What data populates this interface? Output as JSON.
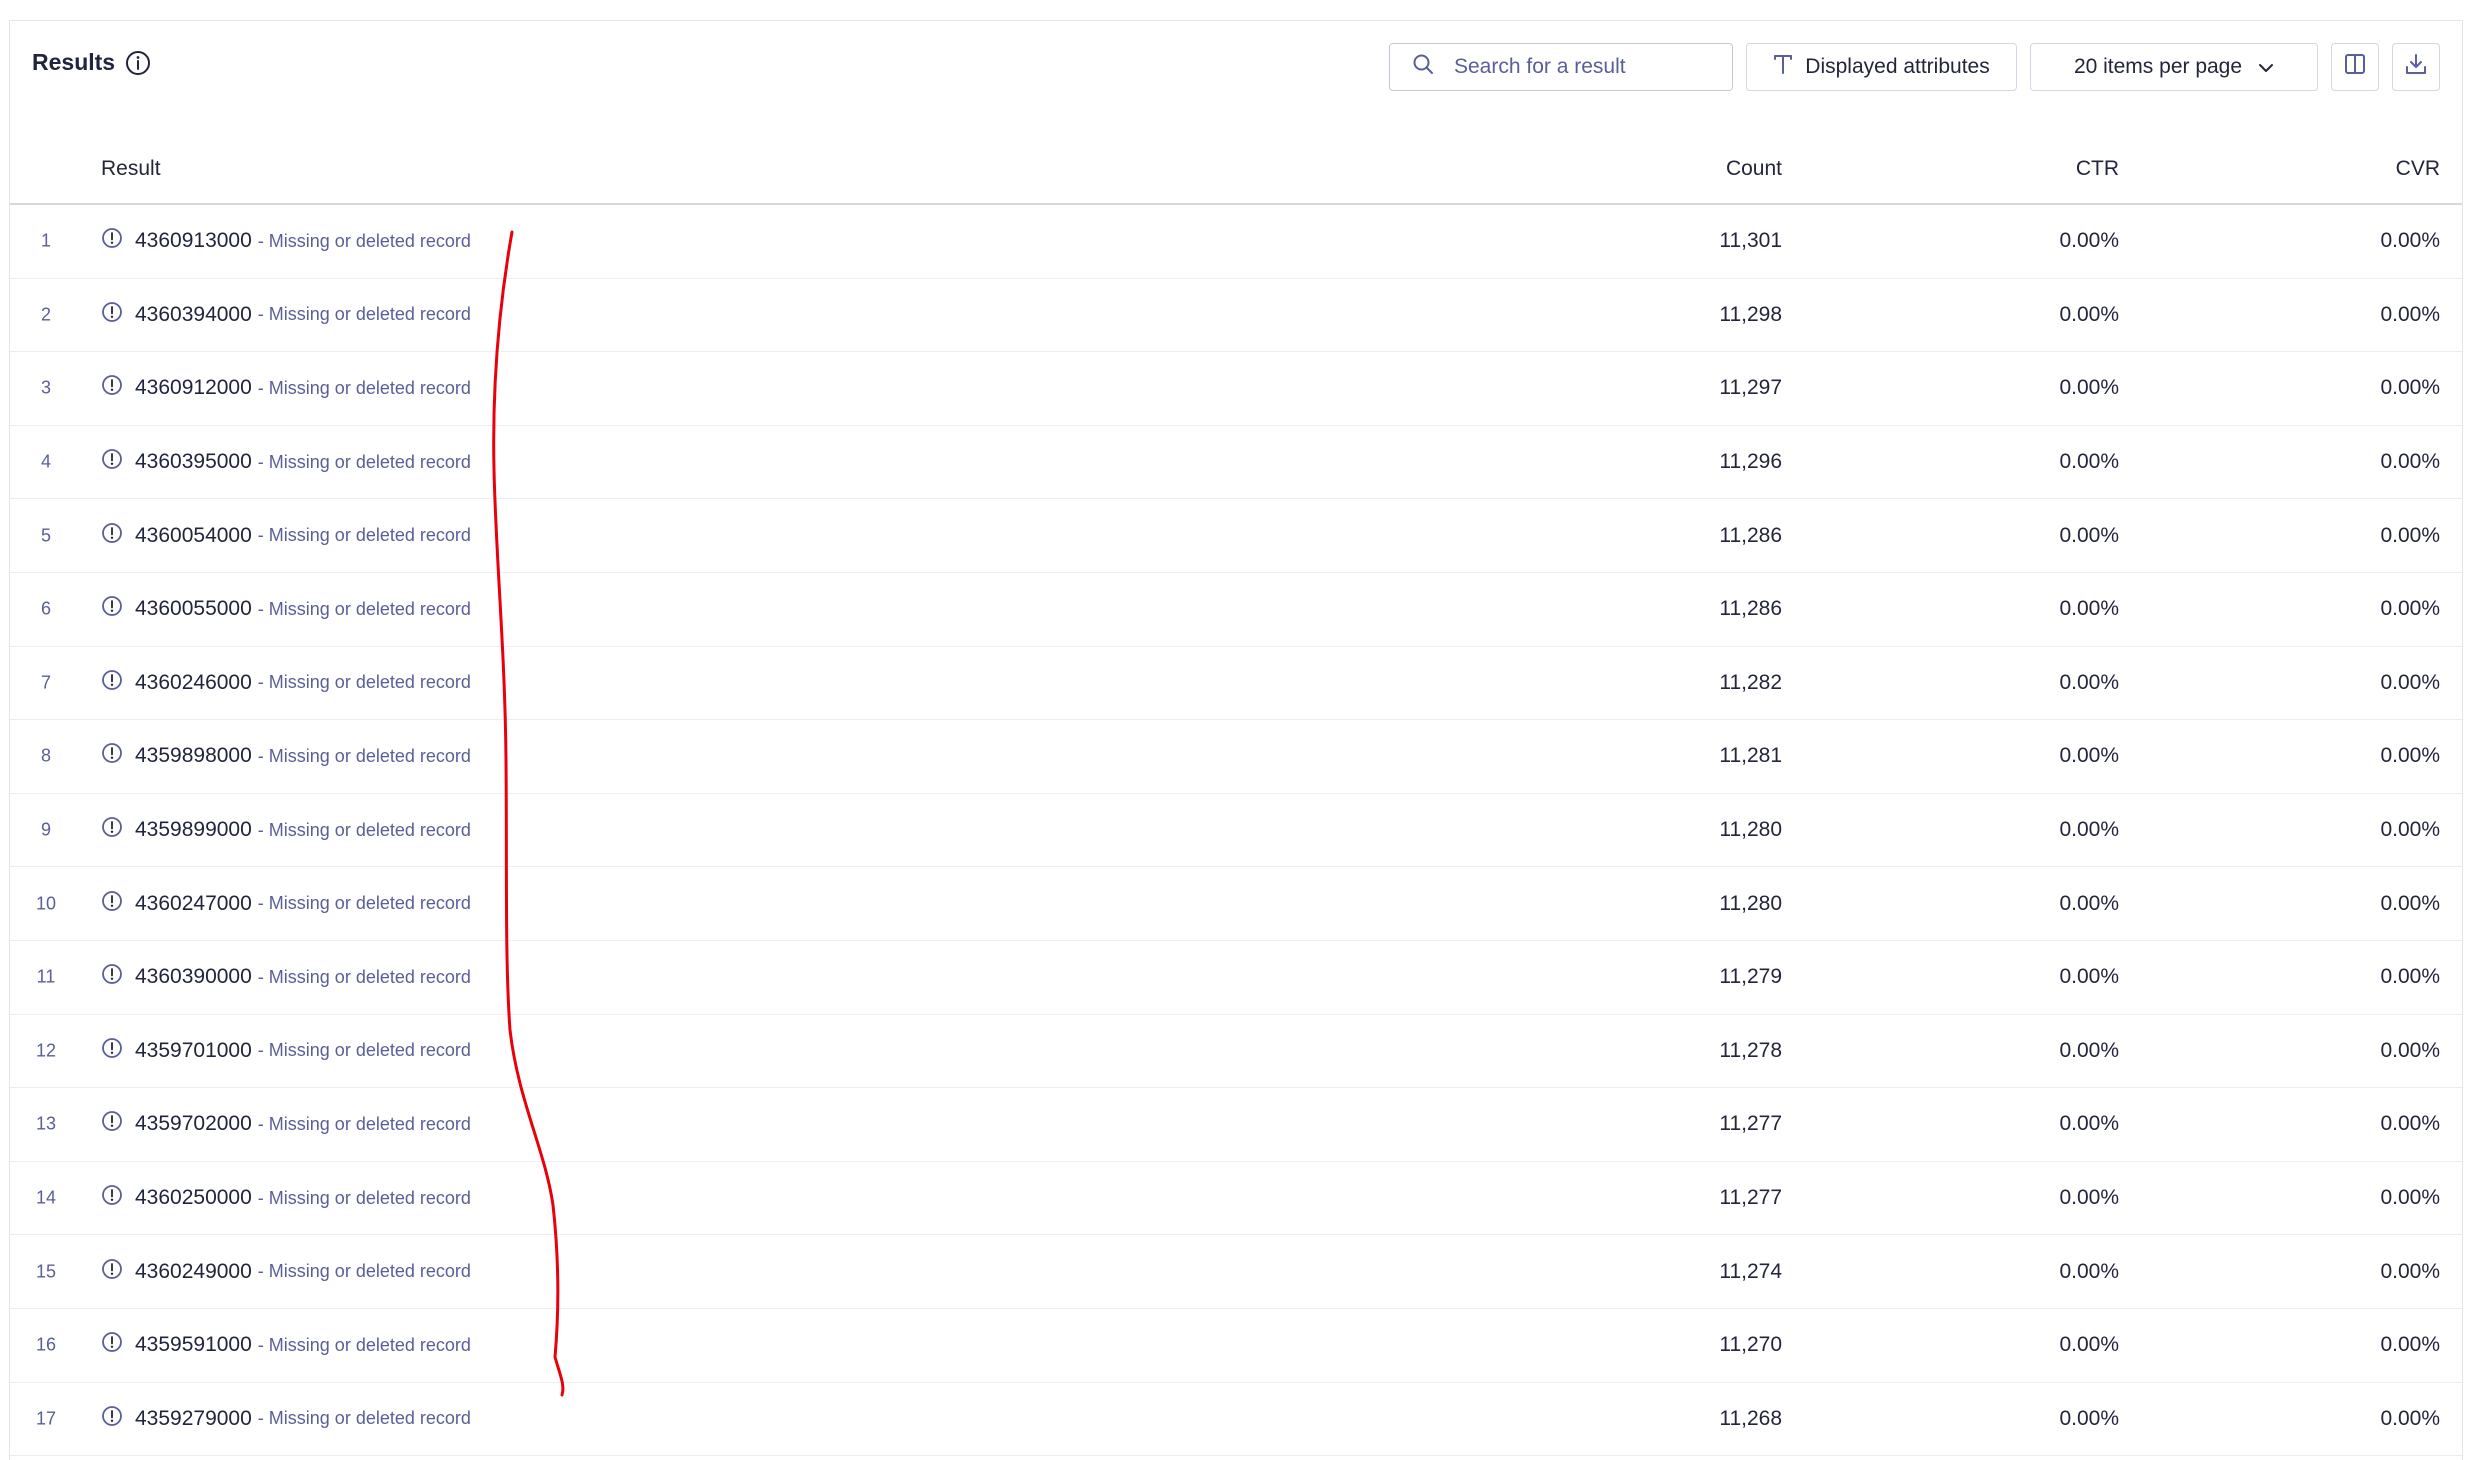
{
  "header": {
    "title": "Results"
  },
  "toolbar": {
    "search_placeholder": "Search for a result",
    "attributes_label": "Displayed attributes",
    "per_page_label": "20 items per page"
  },
  "columns": {
    "result": "Result",
    "count": "Count",
    "ctr": "CTR",
    "cvr": "CVR"
  },
  "rows": [
    {
      "rank": "1",
      "id": "4360913000",
      "note": "- Missing or deleted record",
      "count": "11,301",
      "ctr": "0.00%",
      "cvr": "0.00%"
    },
    {
      "rank": "2",
      "id": "4360394000",
      "note": "- Missing or deleted record",
      "count": "11,298",
      "ctr": "0.00%",
      "cvr": "0.00%"
    },
    {
      "rank": "3",
      "id": "4360912000",
      "note": "- Missing or deleted record",
      "count": "11,297",
      "ctr": "0.00%",
      "cvr": "0.00%"
    },
    {
      "rank": "4",
      "id": "4360395000",
      "note": "- Missing or deleted record",
      "count": "11,296",
      "ctr": "0.00%",
      "cvr": "0.00%"
    },
    {
      "rank": "5",
      "id": "4360054000",
      "note": "- Missing or deleted record",
      "count": "11,286",
      "ctr": "0.00%",
      "cvr": "0.00%"
    },
    {
      "rank": "6",
      "id": "4360055000",
      "note": "- Missing or deleted record",
      "count": "11,286",
      "ctr": "0.00%",
      "cvr": "0.00%"
    },
    {
      "rank": "7",
      "id": "4360246000",
      "note": "- Missing or deleted record",
      "count": "11,282",
      "ctr": "0.00%",
      "cvr": "0.00%"
    },
    {
      "rank": "8",
      "id": "4359898000",
      "note": "- Missing or deleted record",
      "count": "11,281",
      "ctr": "0.00%",
      "cvr": "0.00%"
    },
    {
      "rank": "9",
      "id": "4359899000",
      "note": "- Missing or deleted record",
      "count": "11,280",
      "ctr": "0.00%",
      "cvr": "0.00%"
    },
    {
      "rank": "10",
      "id": "4360247000",
      "note": "- Missing or deleted record",
      "count": "11,280",
      "ctr": "0.00%",
      "cvr": "0.00%"
    },
    {
      "rank": "11",
      "id": "4360390000",
      "note": "- Missing or deleted record",
      "count": "11,279",
      "ctr": "0.00%",
      "cvr": "0.00%"
    },
    {
      "rank": "12",
      "id": "4359701000",
      "note": "- Missing or deleted record",
      "count": "11,278",
      "ctr": "0.00%",
      "cvr": "0.00%"
    },
    {
      "rank": "13",
      "id": "4359702000",
      "note": "- Missing or deleted record",
      "count": "11,277",
      "ctr": "0.00%",
      "cvr": "0.00%"
    },
    {
      "rank": "14",
      "id": "4360250000",
      "note": "- Missing or deleted record",
      "count": "11,277",
      "ctr": "0.00%",
      "cvr": "0.00%"
    },
    {
      "rank": "15",
      "id": "4360249000",
      "note": "- Missing or deleted record",
      "count": "11,274",
      "ctr": "0.00%",
      "cvr": "0.00%"
    },
    {
      "rank": "16",
      "id": "4359591000",
      "note": "- Missing or deleted record",
      "count": "11,270",
      "ctr": "0.00%",
      "cvr": "0.00%"
    },
    {
      "rank": "17",
      "id": "4359279000",
      "note": "- Missing or deleted record",
      "count": "11,268",
      "ctr": "0.00%",
      "cvr": "0.00%"
    }
  ],
  "icons": {
    "info": "info-icon",
    "search": "search-icon",
    "attributes": "text-t-icon",
    "per_page": "chevron-down-icon",
    "columns": "columns-icon",
    "download": "download-icon",
    "row_warning": "exclamation-circle-icon"
  },
  "colors": {
    "text": "#21243d",
    "muted": "#5a5e9a",
    "border": "#d6d6e7",
    "annotation": "#e8000b"
  }
}
